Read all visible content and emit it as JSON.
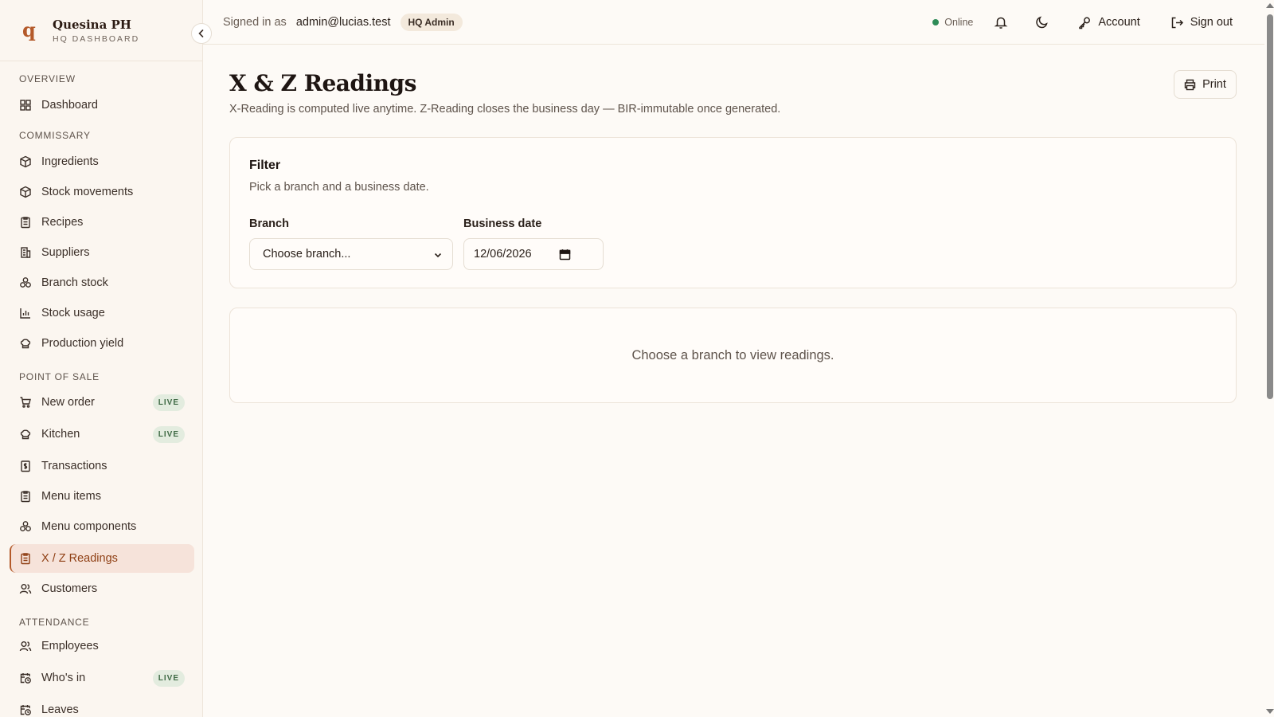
{
  "brand": {
    "logo": "q",
    "title": "Quesina PH",
    "subtitle": "HQ DASHBOARD"
  },
  "sidebar": {
    "sections": [
      {
        "label": "OVERVIEW"
      },
      {
        "label": "COMMISSARY"
      },
      {
        "label": "POINT OF SALE"
      },
      {
        "label": "ATTENDANCE"
      }
    ],
    "items": [
      {
        "label": "Dashboard",
        "icon": "grid-icon"
      },
      {
        "label": "Ingredients",
        "icon": "box-icon"
      },
      {
        "label": "Stock movements",
        "icon": "box-icon"
      },
      {
        "label": "Recipes",
        "icon": "clipboard-icon"
      },
      {
        "label": "Suppliers",
        "icon": "building-icon"
      },
      {
        "label": "Branch stock",
        "icon": "cluster-icon"
      },
      {
        "label": "Stock usage",
        "icon": "bar-chart-icon"
      },
      {
        "label": "Production yield",
        "icon": "chef-hat-icon"
      },
      {
        "label": "New order",
        "icon": "cart-icon",
        "badge": "LIVE"
      },
      {
        "label": "Kitchen",
        "icon": "chef-hat-icon",
        "badge": "LIVE"
      },
      {
        "label": "Transactions",
        "icon": "receipt-icon"
      },
      {
        "label": "Menu items",
        "icon": "clipboard-icon"
      },
      {
        "label": "Menu components",
        "icon": "cluster-icon"
      },
      {
        "label": "X / Z Readings",
        "icon": "clipboard-icon",
        "active": true
      },
      {
        "label": "Customers",
        "icon": "users-icon"
      },
      {
        "label": "Employees",
        "icon": "users-icon"
      },
      {
        "label": "Who's in",
        "icon": "calendar-clock-icon",
        "badge": "LIVE"
      },
      {
        "label": "Leaves",
        "icon": "calendar-clock-icon"
      }
    ]
  },
  "topbar": {
    "signed_in_label": "Signed in as",
    "email": "admin@lucias.test",
    "role": "HQ Admin",
    "status": "Online",
    "account_label": "Account",
    "signout_label": "Sign out"
  },
  "page": {
    "title": "X & Z Readings",
    "subtitle": "X-Reading is computed live anytime. Z-Reading closes the business day — BIR-immutable once generated.",
    "print_label": "Print"
  },
  "filter": {
    "title": "Filter",
    "description": "Pick a branch and a business date.",
    "branch_label": "Branch",
    "branch_value": "Choose branch...",
    "date_label": "Business date",
    "date_value": "12/06/2026"
  },
  "empty_state": "Choose a branch to view readings.",
  "colors": {
    "accent": "#b45a2a",
    "active_bg": "#f6e3da",
    "online": "#2e8b57"
  }
}
